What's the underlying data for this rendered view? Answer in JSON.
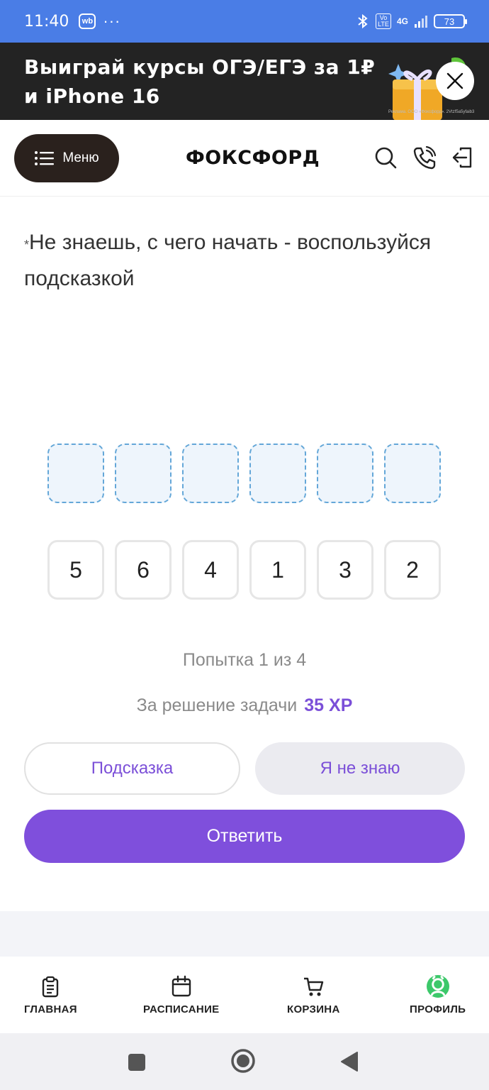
{
  "status_bar": {
    "time": "11:40",
    "wb_badge": "wb",
    "more": "···",
    "network": "4G",
    "volte": "Vo LTE",
    "battery": "73"
  },
  "banner": {
    "title": "Выиграй курсы ОГЭ/ЕГЭ за 1₽ и iPhone 16",
    "legal": "Реклама. ООО «Фоксфорд». 2Vtzf5a5yfaib3"
  },
  "header": {
    "menu_label": "Меню",
    "logo": "ФОКСФОРД"
  },
  "task": {
    "hint_mark": "*",
    "hint_text": "Не знаешь, с чего начать - воспользуйся подсказкой",
    "tiles": [
      "5",
      "6",
      "4",
      "1",
      "3",
      "2"
    ],
    "attempt": "Попытка 1 из 4",
    "reward_label": "За решение задачи",
    "reward_xp": "35 XP"
  },
  "actions": {
    "hint_button": "Подсказка",
    "dont_know_button": "Я не знаю",
    "answer_button": "Ответить"
  },
  "bottom_nav": {
    "home": "ГЛАВНАЯ",
    "schedule": "РАСПИСАНИЕ",
    "cart": "КОРЗИНА",
    "profile": "ПРОФИЛЬ"
  },
  "colors": {
    "status_bar": "#4a7de6",
    "banner_bg": "#232323",
    "accent": "#7f4fdc",
    "slot_border": "#64a7d8",
    "profile_green": "#3cc86a"
  }
}
